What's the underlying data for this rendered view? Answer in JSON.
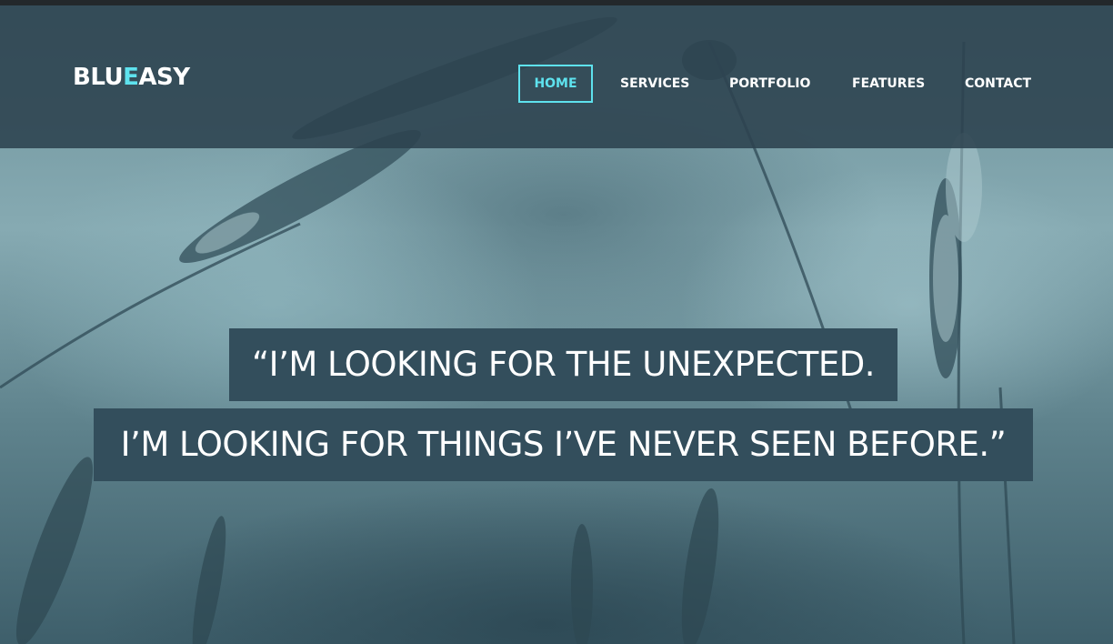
{
  "brand": {
    "name_part1": "BLU",
    "name_accent": "E",
    "name_part2": "ASY"
  },
  "nav": {
    "items": [
      {
        "label": "HOME",
        "active": true
      },
      {
        "label": "SERVICES",
        "active": false
      },
      {
        "label": "PORTFOLIO",
        "active": false
      },
      {
        "label": "FEATURES",
        "active": false
      },
      {
        "label": "CONTACT",
        "active": false
      }
    ]
  },
  "hero": {
    "quote_line_1": "“I’M LOOKING FOR THE UNEXPECTED.",
    "quote_line_2": "I’M LOOKING FOR THINGS I’VE NEVER SEEN BEFORE.”"
  },
  "colors": {
    "accent": "#5ee2ee",
    "navbar": "#2c424f",
    "quote_box": "#334e5c",
    "text": "#ffffff"
  }
}
